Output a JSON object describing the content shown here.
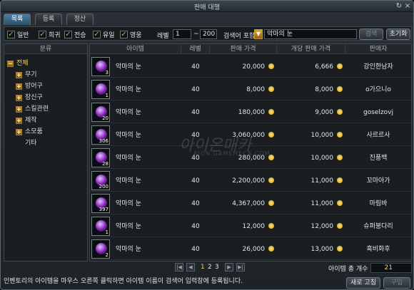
{
  "window": {
    "title": "판매 대행"
  },
  "tabs": [
    {
      "label": "목록"
    },
    {
      "label": "등록"
    },
    {
      "label": "정산"
    }
  ],
  "filters": {
    "checkboxes": [
      {
        "label": "일반"
      },
      {
        "label": "희귀"
      },
      {
        "label": "전승"
      },
      {
        "label": "유일"
      },
      {
        "label": "영웅"
      }
    ],
    "level_label": "레벨",
    "level_min": "1",
    "level_sep": "~",
    "level_max": "200",
    "search_mode": "검색어 포함",
    "search_value": "악마의 눈",
    "search_button": "검색",
    "reset_button": "초기화"
  },
  "categories": {
    "header": "분류",
    "items": [
      {
        "label": "전체",
        "toggle": "−",
        "selected": true
      },
      {
        "label": "무기",
        "toggle": "+"
      },
      {
        "label": "방어구",
        "toggle": "+"
      },
      {
        "label": "장신구",
        "toggle": "+"
      },
      {
        "label": "스킬관련",
        "toggle": "+"
      },
      {
        "label": "제작",
        "toggle": "+"
      },
      {
        "label": "소모품",
        "toggle": "+"
      },
      {
        "label": "기타",
        "toggle": ""
      }
    ]
  },
  "table": {
    "columns": [
      "아이템",
      "레벨",
      "판매 가격",
      "개당 판매 가격",
      "판매자"
    ],
    "rows": [
      {
        "qty": "3",
        "name": "악마의 눈",
        "level": "40",
        "price": "20,000",
        "unit_price": "6,666",
        "seller": "강인한남자"
      },
      {
        "qty": "1",
        "name": "악마의 눈",
        "level": "40",
        "price": "8,000",
        "unit_price": "8,000",
        "seller": "o가으니o"
      },
      {
        "qty": "20",
        "name": "악마의 눈",
        "level": "40",
        "price": "180,000",
        "unit_price": "9,000",
        "seller": "goselzovj"
      },
      {
        "qty": "306",
        "name": "악마의 눈",
        "level": "40",
        "price": "3,060,000",
        "unit_price": "10,000",
        "seller": "사르르사"
      },
      {
        "qty": "28",
        "name": "악마의 눈",
        "level": "40",
        "price": "280,000",
        "unit_price": "10,000",
        "seller": "진풍백"
      },
      {
        "qty": "200",
        "name": "악마의 눈",
        "level": "40",
        "price": "2,200,000",
        "unit_price": "11,000",
        "seller": "꼬마아가"
      },
      {
        "qty": "397",
        "name": "악마의 눈",
        "level": "40",
        "price": "4,367,000",
        "unit_price": "11,000",
        "seller": "마림바"
      },
      {
        "qty": "1",
        "name": "악마의 눈",
        "level": "40",
        "price": "12,000",
        "unit_price": "12,000",
        "seller": "슈퍼붕다리"
      },
      {
        "qty": "2",
        "name": "악마의 눈",
        "level": "40",
        "price": "26,000",
        "unit_price": "13,000",
        "seller": "흑비화후"
      }
    ]
  },
  "pager": {
    "pages": [
      "1",
      "2",
      "3"
    ],
    "current": "1"
  },
  "footer": {
    "total_label": "아이템 총 개수",
    "total_count": "21",
    "hint": "인벤토리의 아이템을 마우스 오른쪽 클릭하면 아이템 이름이 검색어 입력창에 등록됩니다.",
    "refresh_button": "새로 고침",
    "buy_button": "구입"
  },
  "watermark": {
    "brand": "아이온매카",
    "site": "AION.GAMEMECA.COM"
  },
  "colors": {
    "accent": "#4e7fa0",
    "gold": "#f6d36b",
    "check": "#7fd35a"
  }
}
